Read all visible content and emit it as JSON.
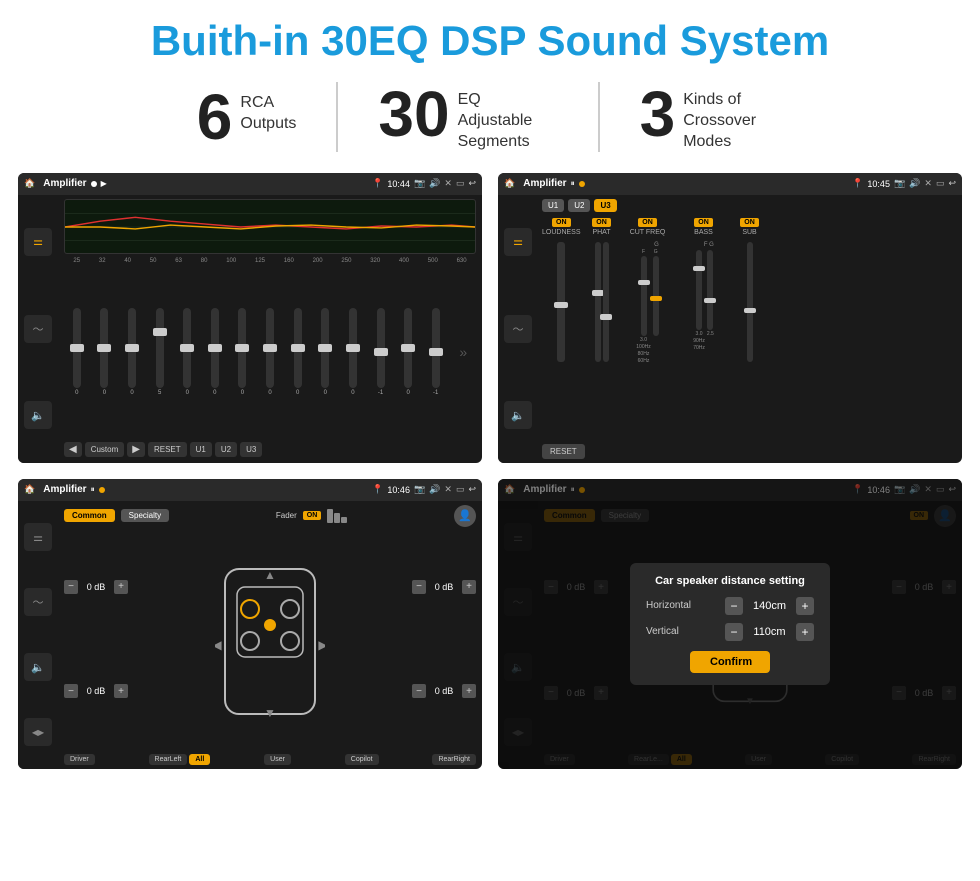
{
  "header": {
    "title": "Buith-in 30EQ DSP Sound System"
  },
  "stats": [
    {
      "number": "6",
      "text": "RCA\nOutputs"
    },
    {
      "number": "30",
      "text": "EQ Adjustable\nSegments"
    },
    {
      "number": "3",
      "text": "Kinds of\nCrossover Modes"
    }
  ],
  "screens": [
    {
      "id": "screen1",
      "time": "10:44",
      "title": "Amplifier",
      "eq_preset": "Custom",
      "freq_labels": [
        "25",
        "32",
        "40",
        "50",
        "63",
        "80",
        "100",
        "125",
        "160",
        "200",
        "250",
        "320",
        "400",
        "500",
        "630"
      ],
      "slider_vals": [
        "0",
        "0",
        "0",
        "5",
        "0",
        "0",
        "0",
        "0",
        "0",
        "0",
        "0",
        "-1",
        "0",
        "-1"
      ],
      "preset_btns": [
        "RESET",
        "U1",
        "U2",
        "U3"
      ]
    },
    {
      "id": "screen2",
      "time": "10:45",
      "title": "Amplifier",
      "channels": [
        "LOUDNESS",
        "PHAT",
        "CUT FREQ",
        "BASS",
        "SUB"
      ],
      "presets": [
        "U1",
        "U2",
        "U3"
      ],
      "reset_label": "RESET"
    },
    {
      "id": "screen3",
      "time": "10:46",
      "title": "Amplifier",
      "tabs": [
        "Common",
        "Specialty"
      ],
      "fader_label": "Fader",
      "zone_btns": [
        "Driver",
        "Copilot",
        "RearLeft",
        "All",
        "User",
        "RearRight"
      ],
      "db_values": [
        "0 dB",
        "0 dB",
        "0 dB",
        "0 dB"
      ]
    },
    {
      "id": "screen4",
      "time": "10:46",
      "title": "Amplifier",
      "dialog": {
        "title": "Car speaker distance setting",
        "fields": [
          {
            "label": "Horizontal",
            "value": "140cm"
          },
          {
            "label": "Vertical",
            "value": "110cm"
          }
        ],
        "confirm_label": "Confirm"
      }
    }
  ]
}
